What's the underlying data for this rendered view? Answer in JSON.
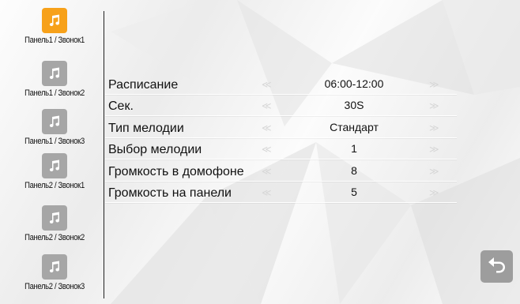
{
  "sidebar": {
    "items": [
      {
        "label": "Панель1 / Звонок1",
        "active": true,
        "icon": "music-note-icon"
      },
      {
        "label": "Панель1 / Звонок2",
        "active": false,
        "icon": "music-note-icon"
      },
      {
        "label": "Панель1 / Звонок3",
        "active": false,
        "icon": "music-note-icon"
      },
      {
        "label": "Панель2 / Звонок1",
        "active": false,
        "icon": "music-note-icon"
      },
      {
        "label": "Панель2 / Звонок2",
        "active": false,
        "icon": "music-note-icon"
      },
      {
        "label": "Панель2 / Звонок3",
        "active": false,
        "icon": "music-note-icon"
      }
    ]
  },
  "settings": {
    "rows": [
      {
        "label": "Расписание",
        "value": "06:00-12:00"
      },
      {
        "label": "Сек.",
        "value": "30S"
      },
      {
        "label": "Тип мелодии",
        "value": "Стандарт"
      },
      {
        "label": "Выбор мелодии",
        "value": "1"
      },
      {
        "label": "Громкость в домофоне",
        "value": "8"
      },
      {
        "label": "Громкость на панели",
        "value": "5"
      }
    ],
    "arrow_left_glyph": "≪",
    "arrow_right_glyph": "≫"
  },
  "controls": {
    "back_icon": "back-arrow-icon"
  },
  "colors": {
    "active_icon_bg": "#f7a11a",
    "inactive_icon_bg": "#a6a6a6",
    "back_button_bg": "#9d9d9d",
    "arrow_color": "#d6d6d6"
  }
}
